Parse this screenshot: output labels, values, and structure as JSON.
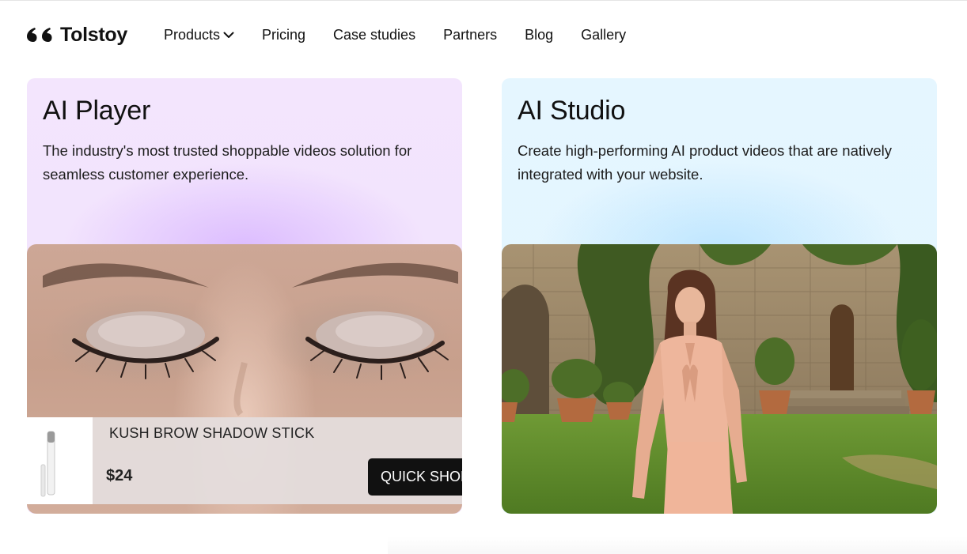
{
  "brand": {
    "name": "Tolstoy",
    "logo_icon": "quote-marks-icon"
  },
  "nav": {
    "items": [
      {
        "label": "Products",
        "has_dropdown": true
      },
      {
        "label": "Pricing"
      },
      {
        "label": "Case studies"
      },
      {
        "label": "Partners"
      },
      {
        "label": "Blog"
      },
      {
        "label": "Gallery"
      }
    ]
  },
  "cards": [
    {
      "title": "AI Player",
      "description": "The industry's most trusted shoppable videos solution for seamless customer experience.",
      "accent": "#f2e3fd",
      "product_overlay": {
        "name": "KUSH BROW SHADOW STICK",
        "price": "$24",
        "button_label": "QUICK SHOP"
      }
    },
    {
      "title": "AI Studio",
      "description": "Create high-performing AI product videos that are natively integrated with your website.",
      "accent": "#e3f5fe"
    }
  ]
}
